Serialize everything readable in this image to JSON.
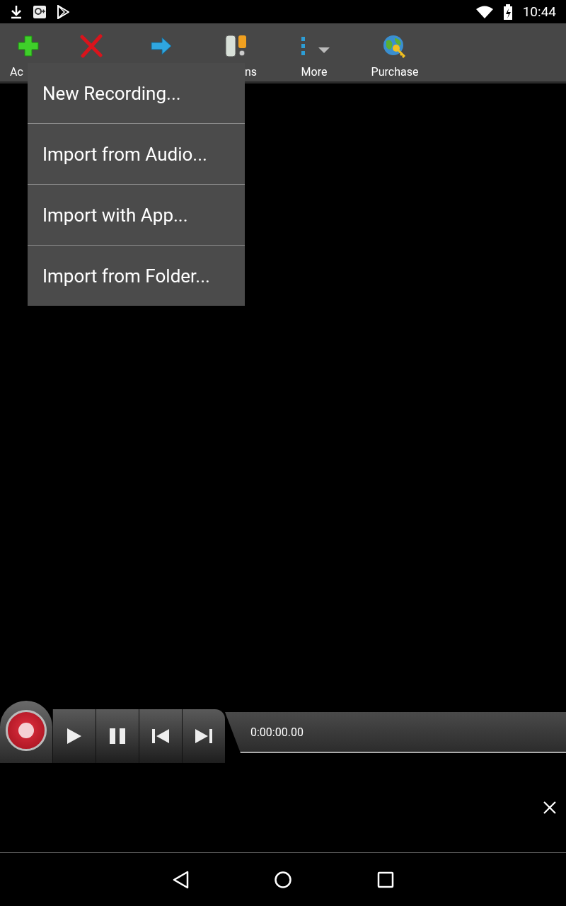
{
  "status_bar": {
    "time": "10:44"
  },
  "toolbar": {
    "items": [
      {
        "kind": "add",
        "label": "Ac"
      },
      {
        "kind": "delete"
      },
      {
        "kind": "share"
      },
      {
        "kind": "options",
        "label": "ns"
      },
      {
        "kind": "more",
        "label": "More"
      },
      {
        "kind": "purchase",
        "label": "Purchase"
      }
    ]
  },
  "menu": {
    "items": [
      "New Recording...",
      "Import from Audio...",
      "Import with App...",
      "Import from Folder..."
    ]
  },
  "player": {
    "time": "0:00:00.00"
  }
}
